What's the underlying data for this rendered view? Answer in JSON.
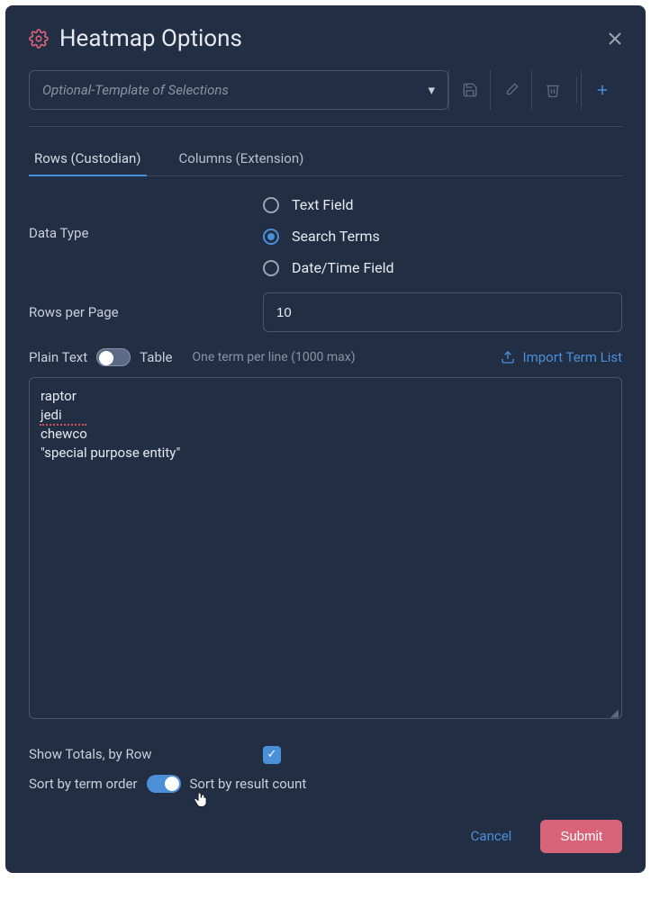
{
  "header": {
    "title": "Heatmap Options"
  },
  "template": {
    "placeholder": "Optional-Template of Selections"
  },
  "tabs": {
    "rows": "Rows (Custodian)",
    "columns": "Columns (Extension)"
  },
  "dataType": {
    "label": "Data Type",
    "options": {
      "text": "Text Field",
      "search": "Search Terms",
      "date": "Date/Time Field"
    },
    "selected": "search"
  },
  "rowsPerPage": {
    "label": "Rows per Page",
    "value": "10"
  },
  "textMode": {
    "left": "Plain Text",
    "right": "Table",
    "hint": "One term per line (1000 max)",
    "import": "Import Term List"
  },
  "terms": "raptor\njedi\nchewco\n\"special purpose entity\"",
  "showTotals": {
    "label": "Show Totals, by Row",
    "checked": true
  },
  "sort": {
    "left": "Sort by term order",
    "right": "Sort by result count"
  },
  "footer": {
    "cancel": "Cancel",
    "submit": "Submit"
  }
}
